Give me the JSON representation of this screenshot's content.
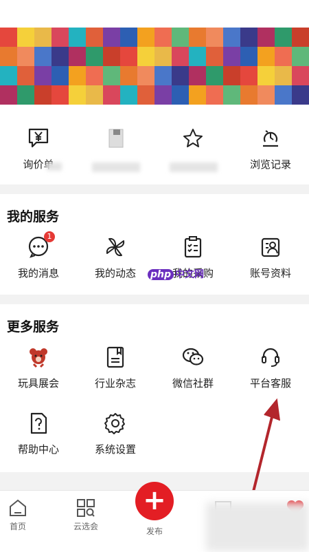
{
  "banner": {
    "colors": [
      "#e5473d",
      "#4a77c9",
      "#f3a11f",
      "#d9475c",
      "#2f9a6b",
      "#e87a2f",
      "#7a3fa5",
      "#f5d03a",
      "#3a3a8a",
      "#ef6d52",
      "#23b2c0",
      "#c93f2b",
      "#f08a5d",
      "#2d5fb3",
      "#e9b949",
      "#b03060",
      "#5fb87a",
      "#e0603a"
    ]
  },
  "quick_links": [
    {
      "label": "询价单",
      "icon": "yen-chat-icon"
    },
    {
      "label": "",
      "icon": "document-icon"
    },
    {
      "label": "",
      "icon": "star-icon"
    },
    {
      "label": "浏览记录",
      "icon": "history-icon"
    }
  ],
  "my_services": {
    "title": "我的服务",
    "items": [
      {
        "label": "我的消息",
        "icon": "message-icon",
        "badge": "1"
      },
      {
        "label": "我的动态",
        "icon": "pinwheel-icon"
      },
      {
        "label": "我的采购",
        "icon": "checklist-icon"
      },
      {
        "label": "账号资料",
        "icon": "account-icon"
      }
    ]
  },
  "more_services": {
    "title": "更多服务",
    "items": [
      {
        "label": "玩具展会",
        "icon": "toy-bear-icon"
      },
      {
        "label": "行业杂志",
        "icon": "magazine-icon"
      },
      {
        "label": "微信社群",
        "icon": "wechat-icon"
      },
      {
        "label": "平台客服",
        "icon": "headset-icon"
      },
      {
        "label": "帮助中心",
        "icon": "help-icon"
      },
      {
        "label": "系统设置",
        "icon": "settings-icon"
      }
    ]
  },
  "watermark": {
    "logo": "php",
    "text": "中文网"
  },
  "tabbar": {
    "items": [
      {
        "label": "首页",
        "icon": "home-icon"
      },
      {
        "label": "云选会",
        "icon": "grid-search-icon"
      },
      {
        "label": "发布",
        "icon": "plus-icon"
      },
      {
        "label": "",
        "icon": "chat-icon"
      },
      {
        "label": "",
        "icon": "heart-icon"
      }
    ],
    "accent": "#e31e24"
  }
}
